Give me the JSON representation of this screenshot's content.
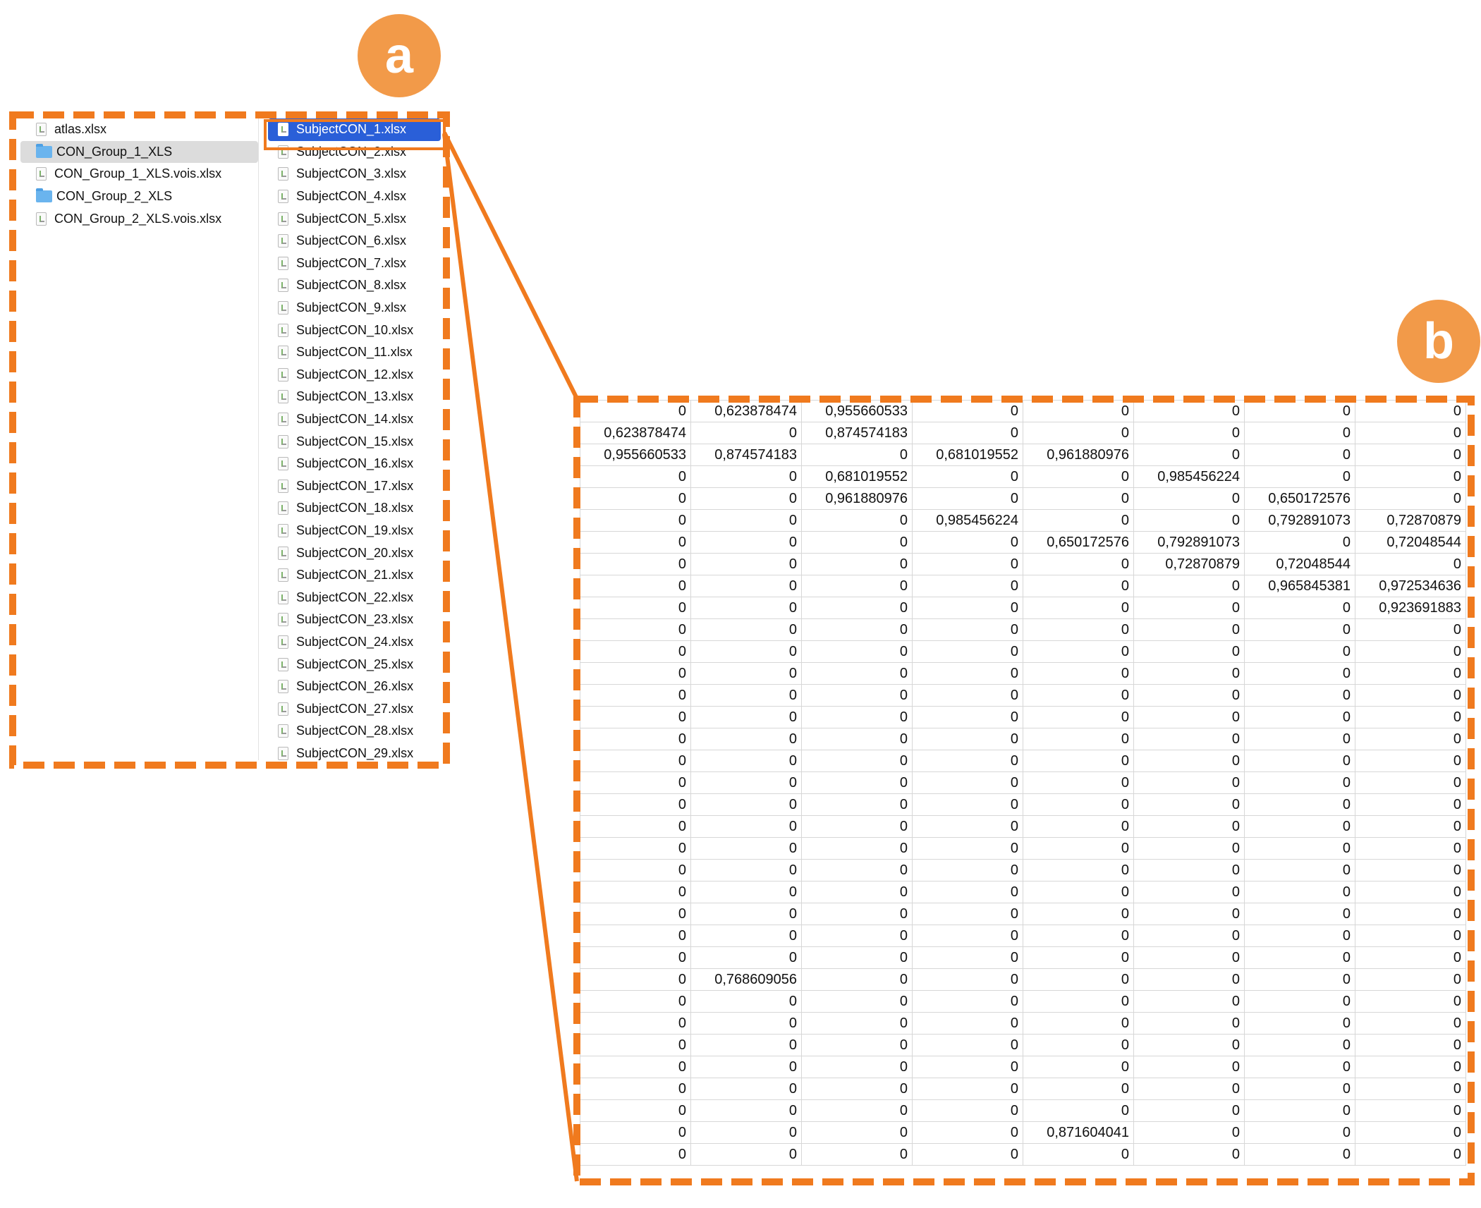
{
  "badges": {
    "a": "a",
    "b": "b"
  },
  "colors": {
    "accent_orange": "#f07a1e",
    "badge_orange": "#f29a49",
    "selection_blue": "#2a5fd8"
  },
  "finder": {
    "column1": [
      {
        "label": "atlas.xlsx",
        "icon": "spreadsheet-file-icon"
      },
      {
        "label": "CON_Group_1_XLS",
        "icon": "folder-icon",
        "selected": true
      },
      {
        "label": "CON_Group_1_XLS.vois.xlsx",
        "icon": "spreadsheet-file-icon"
      },
      {
        "label": "CON_Group_2_XLS",
        "icon": "folder-icon"
      },
      {
        "label": "CON_Group_2_XLS.vois.xlsx",
        "icon": "spreadsheet-file-icon"
      }
    ],
    "column2": [
      "SubjectCON_1.xlsx",
      "SubjectCON_2.xlsx",
      "SubjectCON_3.xlsx",
      "SubjectCON_4.xlsx",
      "SubjectCON_5.xlsx",
      "SubjectCON_6.xlsx",
      "SubjectCON_7.xlsx",
      "SubjectCON_8.xlsx",
      "SubjectCON_9.xlsx",
      "SubjectCON_10.xlsx",
      "SubjectCON_11.xlsx",
      "SubjectCON_12.xlsx",
      "SubjectCON_13.xlsx",
      "SubjectCON_14.xlsx",
      "SubjectCON_15.xlsx",
      "SubjectCON_16.xlsx",
      "SubjectCON_17.xlsx",
      "SubjectCON_18.xlsx",
      "SubjectCON_19.xlsx",
      "SubjectCON_20.xlsx",
      "SubjectCON_21.xlsx",
      "SubjectCON_22.xlsx",
      "SubjectCON_23.xlsx",
      "SubjectCON_24.xlsx",
      "SubjectCON_25.xlsx",
      "SubjectCON_26.xlsx",
      "SubjectCON_27.xlsx",
      "SubjectCON_28.xlsx",
      "SubjectCON_29.xlsx"
    ],
    "column2_selected_index": 0
  },
  "sheet": {
    "rows": [
      [
        "0",
        "0,623878474",
        "0,955660533",
        "0",
        "0",
        "0",
        "0",
        "0"
      ],
      [
        "0,623878474",
        "0",
        "0,874574183",
        "0",
        "0",
        "0",
        "0",
        "0"
      ],
      [
        "0,955660533",
        "0,874574183",
        "0",
        "0,681019552",
        "0,961880976",
        "0",
        "0",
        "0"
      ],
      [
        "0",
        "0",
        "0,681019552",
        "0",
        "0",
        "0,985456224",
        "0",
        "0"
      ],
      [
        "0",
        "0",
        "0,961880976",
        "0",
        "0",
        "0",
        "0,650172576",
        "0"
      ],
      [
        "0",
        "0",
        "0",
        "0,985456224",
        "0",
        "0",
        "0,792891073",
        "0,72870879"
      ],
      [
        "0",
        "0",
        "0",
        "0",
        "0,650172576",
        "0,792891073",
        "0",
        "0,72048544"
      ],
      [
        "0",
        "0",
        "0",
        "0",
        "0",
        "0,72870879",
        "0,72048544",
        "0"
      ],
      [
        "0",
        "0",
        "0",
        "0",
        "0",
        "0",
        "0,965845381",
        "0,972534636"
      ],
      [
        "0",
        "0",
        "0",
        "0",
        "0",
        "0",
        "0",
        "0,923691883"
      ],
      [
        "0",
        "0",
        "0",
        "0",
        "0",
        "0",
        "0",
        "0"
      ],
      [
        "0",
        "0",
        "0",
        "0",
        "0",
        "0",
        "0",
        "0"
      ],
      [
        "0",
        "0",
        "0",
        "0",
        "0",
        "0",
        "0",
        "0"
      ],
      [
        "0",
        "0",
        "0",
        "0",
        "0",
        "0",
        "0",
        "0"
      ],
      [
        "0",
        "0",
        "0",
        "0",
        "0",
        "0",
        "0",
        "0"
      ],
      [
        "0",
        "0",
        "0",
        "0",
        "0",
        "0",
        "0",
        "0"
      ],
      [
        "0",
        "0",
        "0",
        "0",
        "0",
        "0",
        "0",
        "0"
      ],
      [
        "0",
        "0",
        "0",
        "0",
        "0",
        "0",
        "0",
        "0"
      ],
      [
        "0",
        "0",
        "0",
        "0",
        "0",
        "0",
        "0",
        "0"
      ],
      [
        "0",
        "0",
        "0",
        "0",
        "0",
        "0",
        "0",
        "0"
      ],
      [
        "0",
        "0",
        "0",
        "0",
        "0",
        "0",
        "0",
        "0"
      ],
      [
        "0",
        "0",
        "0",
        "0",
        "0",
        "0",
        "0",
        "0"
      ],
      [
        "0",
        "0",
        "0",
        "0",
        "0",
        "0",
        "0",
        "0"
      ],
      [
        "0",
        "0",
        "0",
        "0",
        "0",
        "0",
        "0",
        "0"
      ],
      [
        "0",
        "0",
        "0",
        "0",
        "0",
        "0",
        "0",
        "0"
      ],
      [
        "0",
        "0",
        "0",
        "0",
        "0",
        "0",
        "0",
        "0"
      ],
      [
        "0",
        "0,768609056",
        "0",
        "0",
        "0",
        "0",
        "0",
        "0"
      ],
      [
        "0",
        "0",
        "0",
        "0",
        "0",
        "0",
        "0",
        "0"
      ],
      [
        "0",
        "0",
        "0",
        "0",
        "0",
        "0",
        "0",
        "0"
      ],
      [
        "0",
        "0",
        "0",
        "0",
        "0",
        "0",
        "0",
        "0"
      ],
      [
        "0",
        "0",
        "0",
        "0",
        "0",
        "0",
        "0",
        "0"
      ],
      [
        "0",
        "0",
        "0",
        "0",
        "0",
        "0",
        "0",
        "0"
      ],
      [
        "0",
        "0",
        "0",
        "0",
        "0",
        "0",
        "0",
        "0"
      ],
      [
        "0",
        "0",
        "0",
        "0",
        "0,871604041",
        "0",
        "0",
        "0"
      ],
      [
        "0",
        "0",
        "0",
        "0",
        "0",
        "0",
        "0",
        "0"
      ]
    ]
  }
}
